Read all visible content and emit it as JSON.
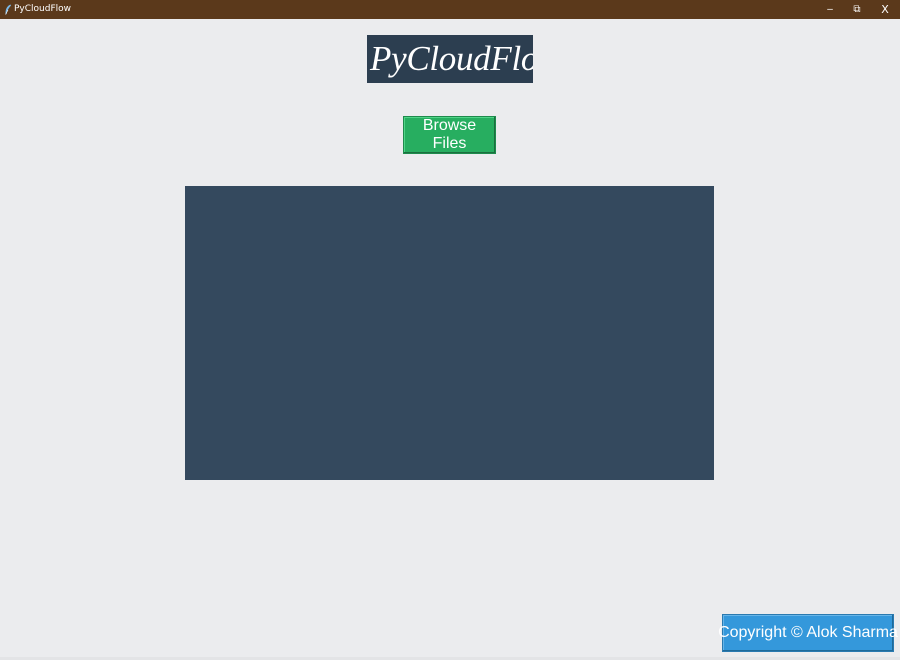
{
  "window": {
    "title": "PyCloudFlow",
    "icon": "feather-app-icon",
    "controls": {
      "minimize": "–",
      "restore": "⧉",
      "close": "X"
    }
  },
  "header": {
    "logo_text": "PyCloudFlow"
  },
  "actions": {
    "browse_label": "Browse Files"
  },
  "footer": {
    "copyright_label": "Copyright © Alok Sharma"
  },
  "colors": {
    "titlebar": "#5B391B",
    "background": "#EBECEE",
    "logo_bg": "#2C3E50",
    "browse_button": "#27AE60",
    "display_panel": "#34495E",
    "copyright_button": "#3498DB"
  }
}
